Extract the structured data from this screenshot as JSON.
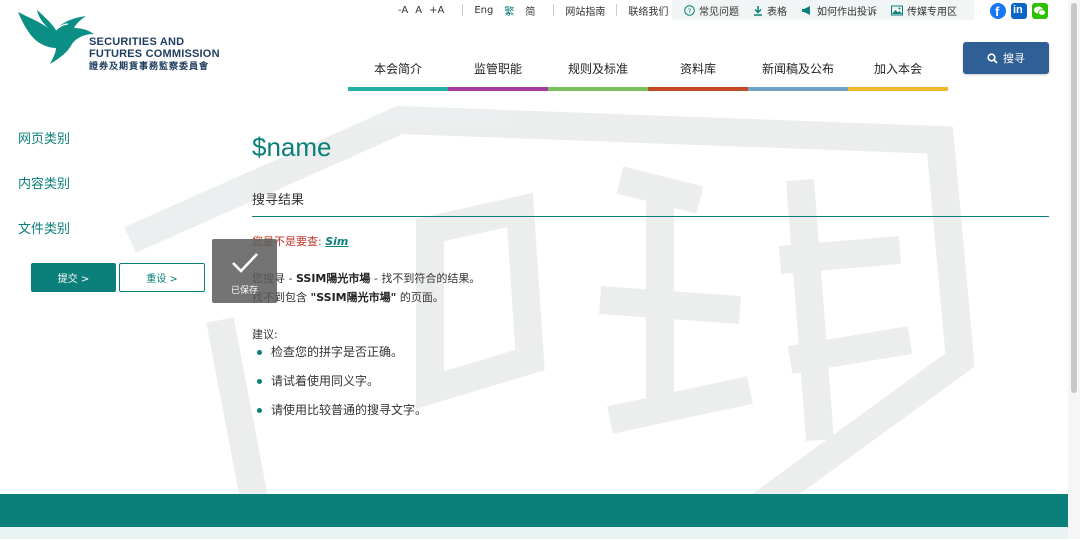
{
  "logo": {
    "name_line1": "SECURITIES AND",
    "name_line2": "FUTURES COMMISSION",
    "name_cn": "證券及期貨事務監察委員會"
  },
  "utility": {
    "font_small": "-A",
    "font_normal": "A",
    "font_large": "+A",
    "lang_en": "Eng",
    "lang_tc": "繁",
    "lang_sc": "简",
    "sitemap": "网站指南",
    "contact": "联络我们",
    "faq": "常见问题",
    "forms": "表格",
    "complaints": "如何作出投诉",
    "media": "传媒专用区"
  },
  "social": {
    "icons": [
      "facebook-icon",
      "linkedin-icon",
      "wechat-icon"
    ],
    "colors": {
      "facebook": "#1877f2",
      "linkedin": "#0a66c2",
      "wechat": "#2dc100"
    }
  },
  "search_button": {
    "label": "搜寻"
  },
  "nav": {
    "tabs": [
      {
        "label": "本会简介",
        "color": "#22b1a4"
      },
      {
        "label": "监管职能",
        "color": "#a63aa0"
      },
      {
        "label": "规则及标准",
        "color": "#7cbf5d"
      },
      {
        "label": "资料库",
        "color": "#c44a24"
      },
      {
        "label": "新闻稿及公布",
        "color": "#6fa2c6"
      },
      {
        "label": "加入本会",
        "color": "#f0b82c"
      }
    ]
  },
  "sidebar": {
    "facets": [
      "网页类别",
      "内容类别",
      "文件类别"
    ],
    "submit": "提交 >",
    "reset": "重设 >"
  },
  "main": {
    "title": "$name",
    "section_title": "搜寻结果",
    "suggest_prefix": "您是不是要查:",
    "suggest_link": "Sim",
    "msg1_prefix": "您搜寻 - ",
    "msg1_term": "SSIM陽光市場",
    "msg1_suffix": " - 找不到符合的结果。",
    "msg2_prefix": "找不到包含 ",
    "msg2_term": "\"SSIM陽光市場\"",
    "msg2_suffix": " 的页面。",
    "tips_label": "建议:",
    "tips": [
      "检查您的拼字是否正确。",
      "请试着使用同义字。",
      "请使用比较普通的搜寻文字。"
    ]
  },
  "toast": {
    "label": "已保存"
  },
  "colors": {
    "accent": "#0b7f7a",
    "search_button": "#2f5f94",
    "suggest_red": "#c0392b"
  }
}
